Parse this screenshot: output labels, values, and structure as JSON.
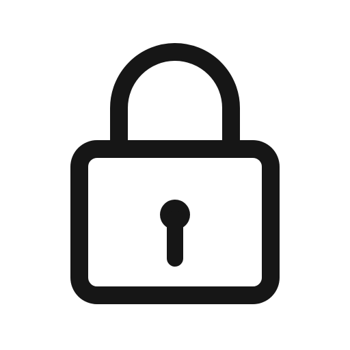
{
  "icon": {
    "name": "lock-icon",
    "stroke_color": "#161616",
    "background_color": "#ffffff"
  }
}
